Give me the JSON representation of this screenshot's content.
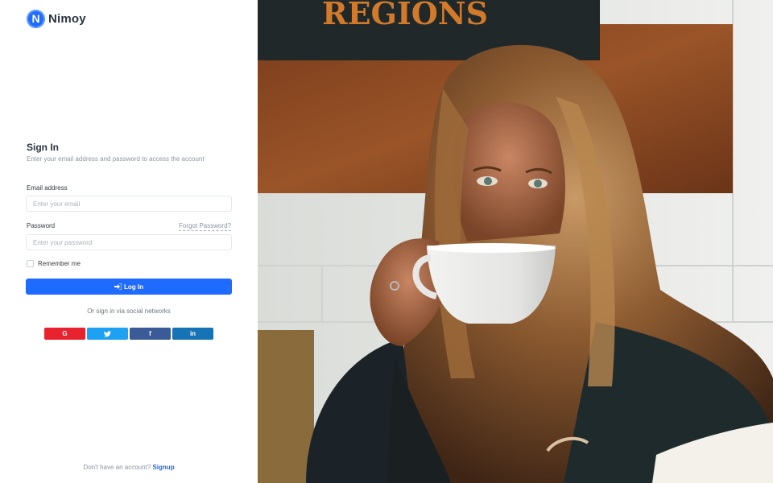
{
  "brand": {
    "logo_letter": "N",
    "name": "Nimoy",
    "accent_color": "#1f6bff"
  },
  "form": {
    "title": "Sign In",
    "subtitle": "Enter your email address and password to access the account",
    "email_label": "Email address",
    "email_placeholder": "Enter your email",
    "password_label": "Password",
    "forgot_password": "Forgot Password?",
    "password_placeholder": "Enter your password",
    "remember_me": "Remember me",
    "login_icon": "login-icon",
    "login_label": "Log In"
  },
  "social": {
    "caption": "Or sign in via social networks",
    "buttons": [
      {
        "network": "google",
        "glyph": "G",
        "color": "#e8222f"
      },
      {
        "network": "twitter",
        "glyph": "twitter-icon",
        "color": "#1da1f2"
      },
      {
        "network": "facebook",
        "glyph": "f",
        "color": "#3a5a98"
      },
      {
        "network": "linkedin",
        "glyph": "in",
        "color": "#1673b6"
      }
    ]
  },
  "footer": {
    "prompt": "Don't have an account?",
    "signup_label": "Signup"
  },
  "background_image": {
    "sign_text": "REGIONS"
  }
}
